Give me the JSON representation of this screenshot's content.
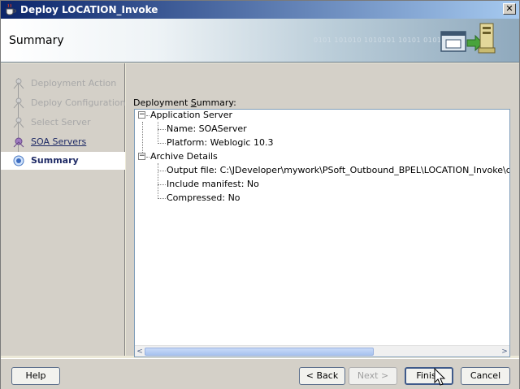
{
  "window": {
    "title": "Deploy LOCATION_Invoke",
    "close_glyph": "✕"
  },
  "banner": {
    "title": "Summary",
    "binary_text": "0101 101010 1010101 10101 0101010"
  },
  "nav": {
    "items": [
      {
        "label": "Deployment Action",
        "state": "disabled"
      },
      {
        "label": "Deploy Configuration",
        "state": "disabled"
      },
      {
        "label": "Select Server",
        "state": "disabled"
      },
      {
        "label": "SOA Servers",
        "state": "visited"
      },
      {
        "label": "Summary",
        "state": "active"
      }
    ]
  },
  "main": {
    "summary_label_prefix": "Deployment ",
    "summary_label_mnemonic": "S",
    "summary_label_suffix": "ummary:",
    "tree": {
      "groups": [
        {
          "label": "Application Server",
          "expander": "−",
          "children": [
            "Name: SOAServer",
            "Platform: Weblogic 10.3"
          ]
        },
        {
          "label": "Archive Details",
          "expander": "−",
          "children": [
            "Output file: C:\\JDeveloper\\mywork\\PSoft_Outbound_BPEL\\LOCATION_Invoke\\deploy\\s",
            "Include manifest: No",
            "Compressed: No"
          ]
        }
      ]
    }
  },
  "scrollbar": {
    "left_arrow": "<",
    "right_arrow": ">"
  },
  "buttons": {
    "help": "Help",
    "back": "< Back",
    "next": "Next >",
    "finish": "Finish",
    "cancel": "Cancel"
  },
  "colors": {
    "title_bar_start": "#0a246a",
    "title_bar_end": "#a6caf0",
    "nav_active_text": "#1f2b66",
    "nav_disabled_text": "#a8a8a8"
  }
}
